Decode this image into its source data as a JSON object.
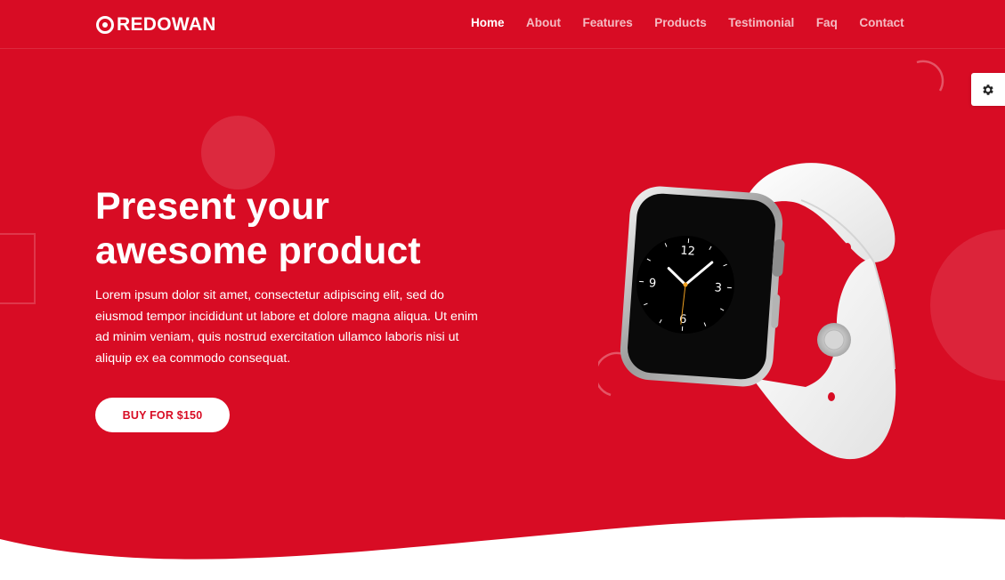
{
  "brand": {
    "name": "REDOWAN",
    "logo_icon": "target-icon"
  },
  "nav": {
    "items": [
      {
        "label": "Home",
        "active": true
      },
      {
        "label": "About",
        "active": false
      },
      {
        "label": "Features",
        "active": false
      },
      {
        "label": "Products",
        "active": false
      },
      {
        "label": "Testimonial",
        "active": false
      },
      {
        "label": "Faq",
        "active": false
      },
      {
        "label": "Contact",
        "active": false
      }
    ]
  },
  "hero": {
    "title": "Present your awesome product",
    "description": "Lorem ipsum dolor sit amet, consectetur adipiscing elit, sed do eiusmod tempor incididunt ut labore et dolore magna aliqua. Ut enim ad minim veniam, quis nostrud exercitation ullamco laboris nisi ut aliquip ex ea commodo consequat.",
    "cta_label": "BUY FOR $150",
    "watch_numbers": [
      "12",
      "3",
      "6",
      "9"
    ]
  },
  "settings": {
    "icon": "gear-icon"
  },
  "colors": {
    "primary": "#d80c24",
    "text_light": "#ffffff",
    "band": "#ececec"
  }
}
